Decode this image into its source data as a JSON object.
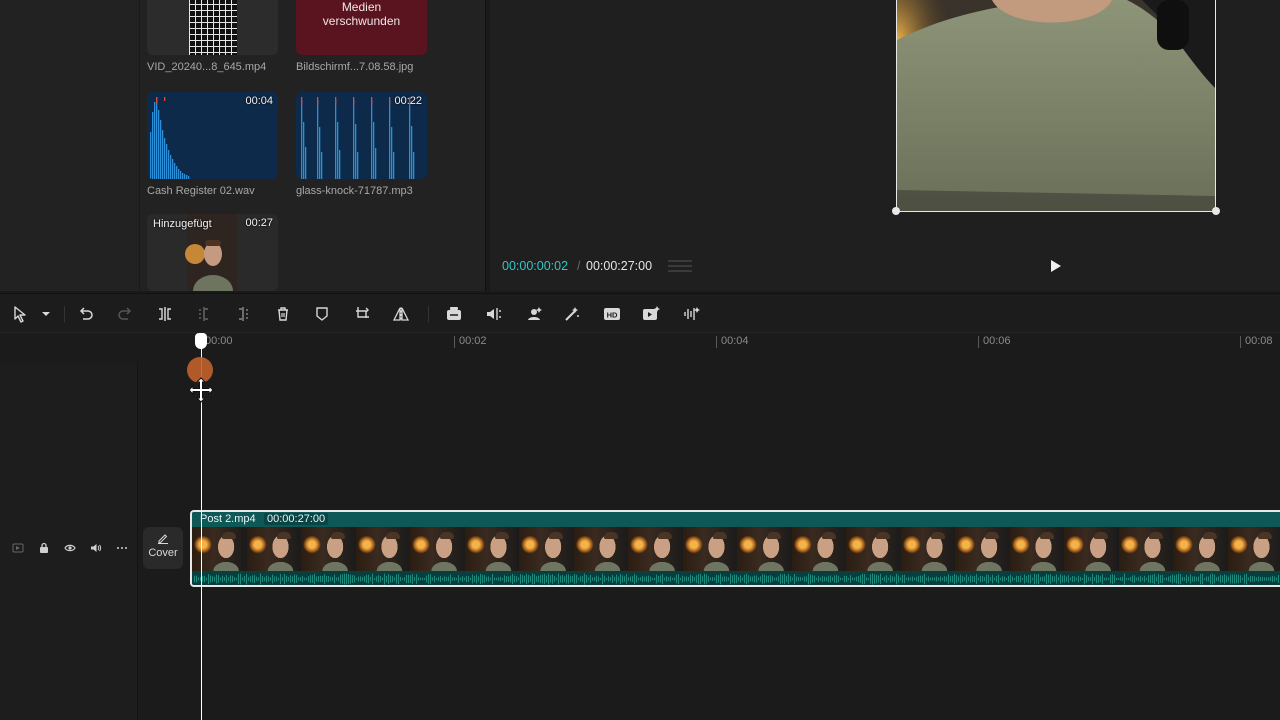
{
  "media": {
    "items": [
      {
        "id": "vid",
        "filename": "VID_20240...8_645.mp4",
        "duration": ""
      },
      {
        "id": "bild",
        "filename": "Bildschirmf...7.08.58.jpg",
        "overlay": "Medien verschwunden"
      },
      {
        "id": "cash",
        "filename": "Cash Register 02.wav",
        "duration": "00:04"
      },
      {
        "id": "glass",
        "filename": "glass-knock-71787.mp3",
        "duration": "00:22"
      },
      {
        "id": "post",
        "filename": "",
        "tag": "Hinzugefügt",
        "duration": "00:27"
      }
    ]
  },
  "player": {
    "current_time": "00:00:00:02",
    "separator": "/",
    "total_time": "00:00:27:00"
  },
  "toolbar": {
    "icons": [
      "select-tool-icon",
      "chevron-down-icon",
      "undo-icon",
      "redo-icon",
      "split-icon",
      "split-left-icon",
      "split-right-icon",
      "delete-icon",
      "marker-icon",
      "crop-icon",
      "mirror-icon",
      "freeze-icon",
      "audio-split-icon",
      "auto-reframe-icon",
      "magic-icon",
      "hd-icon",
      "video-effect-icon",
      "voice-icon"
    ]
  },
  "timeline": {
    "ruler": [
      "00:00",
      "00:02",
      "00:04",
      "00:06",
      "00:08"
    ],
    "cover_label": "Cover",
    "clip": {
      "name": "Post 2.mp4",
      "duration": "00:00:27:00"
    }
  },
  "colors": {
    "accent_time": "#33c6c6",
    "clip_bg": "#0f5858",
    "missing_media": "#5a1420",
    "audio_thumb": "#0e2a4a"
  }
}
